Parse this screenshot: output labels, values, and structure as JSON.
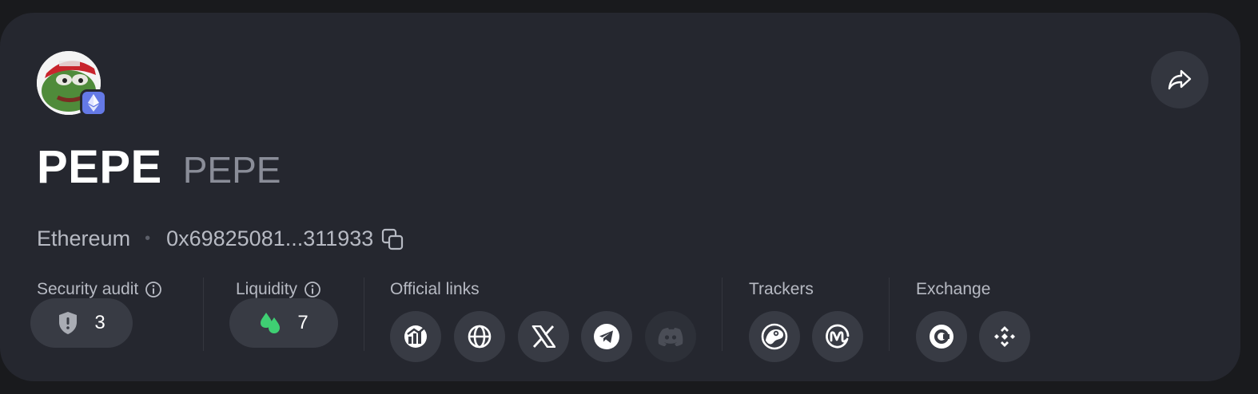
{
  "token": {
    "name": "PEPE",
    "symbol": "PEPE",
    "chain": "Ethereum",
    "address": "0x69825081...311933",
    "chain_badge_color": "#6479e6"
  },
  "sections": {
    "security_audit": {
      "label": "Security audit",
      "count": "3"
    },
    "liquidity": {
      "label": "Liquidity",
      "count": "7"
    },
    "official_links": {
      "label": "Official links",
      "icons": [
        "coinmarket-chart-icon",
        "globe-icon",
        "x-twitter-icon",
        "telegram-icon",
        "discord-icon"
      ]
    },
    "trackers": {
      "label": "Trackers",
      "icons": [
        "coingecko-icon",
        "coinmarketcap-icon"
      ]
    },
    "exchange": {
      "label": "Exchange",
      "icons": [
        "coinbase-icon",
        "binance-icon"
      ]
    }
  },
  "colors": {
    "card": "#25272f",
    "liquidity_green": "#3fcf73",
    "muted": "#8a8d98"
  }
}
